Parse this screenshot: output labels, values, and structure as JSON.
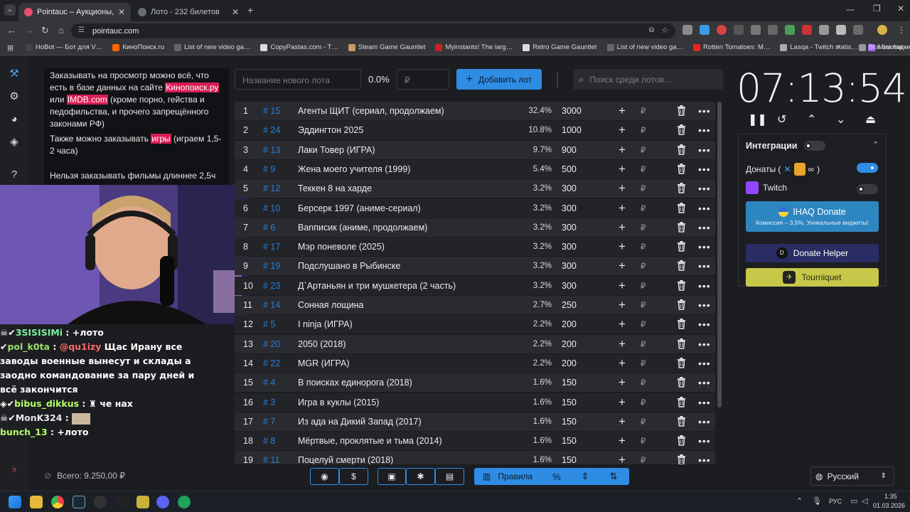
{
  "browser": {
    "tabs": [
      {
        "title": "Pointauc – Аукционы, ястереи…",
        "active": true
      },
      {
        "title": "Лото - 232 билетов",
        "active": false
      }
    ],
    "url": "pointauc.com",
    "bookmarks": [
      "HoBot — Бот для V…",
      "КиноПоиск.ru",
      "List of new video ga…",
      "CopyPastas.com - T…",
      "Steam Game Gauntlet",
      "Myinstants! The larg…",
      "Retro Game Gauntlet",
      "List of new video ga…",
      "Rotten Tomatoes: M…",
      "Lasqa - Twitch statis…",
      "Minichat – The Fast…"
    ],
    "all_bookmarks": "Все закладки"
  },
  "rules_panel": {
    "p1_a": "Заказывать на просмотр можно всё, что есть в базе данных на сайте ",
    "p1_link1": "Кинопоиск.ру",
    "p1_b": " или ",
    "p1_link2": "IMDB.com",
    "p1_c": " (кроме порно, гейства и педофильства, и прочего запрещённого законами РФ)",
    "p2_a": "Также можно заказывать ",
    "p2_hl": "игры",
    "p2_b": " (играем 1,5-2 часа)",
    "p3": "Нельзя заказывать фильмы длиннее 2,5ч"
  },
  "chat": [
    {
      "user": "3SISISIMi",
      "sep": " : ",
      "msg": "+лото"
    },
    {
      "user": "pol_k0ta",
      "sep": " : ",
      "mention": "@qu1izy",
      "msg": " Щас Ирану все заводы военные вынесут и склады а заодно командование за пару дней и всё закончится"
    },
    {
      "user": "bibus_dikkus",
      "sep": " : ",
      "msg": "че нах"
    },
    {
      "user": "MonK324",
      "sep": " : ",
      "msg": ""
    },
    {
      "user": "bunch_13",
      "sep": " : ",
      "msg": "+лото"
    }
  ],
  "footer": {
    "total": "Всего: 9.250,00 ₽"
  },
  "controls": {
    "lot_placeholder": "Название нового лота",
    "percent": "0.0%",
    "rub_placeholder": "₽",
    "add_button": "Добавить лот",
    "search_placeholder": "Поиск среди лотов..."
  },
  "lots": [
    {
      "num": "1",
      "id": "# 15",
      "name": "Агенты ЩИТ (сериал, продолжаем)",
      "pct": "32.4%",
      "amount": "3000"
    },
    {
      "num": "2",
      "id": "# 24",
      "name": "Эддингтон 2025",
      "pct": "10.8%",
      "amount": "1000"
    },
    {
      "num": "3",
      "id": "# 13",
      "name": "Лаки Товер (ИГРА)",
      "pct": "9.7%",
      "amount": "900"
    },
    {
      "num": "4",
      "id": "# 9",
      "name": "Жена моего учителя (1999)",
      "pct": "5.4%",
      "amount": "500"
    },
    {
      "num": "5",
      "id": "# 12",
      "name": "Теккен 8 на харде",
      "pct": "3.2%",
      "amount": "300"
    },
    {
      "num": "6",
      "id": "# 10",
      "name": "Берсерк 1997 (аниме-сериал)",
      "pct": "3.2%",
      "amount": "300"
    },
    {
      "num": "7",
      "id": "# 6",
      "name": "Вanписик (аниме, продолжаем)",
      "pct": "3.2%",
      "amount": "300"
    },
    {
      "num": "8",
      "id": "# 17",
      "name": "Мэр поневоле (2025)",
      "pct": "3.2%",
      "amount": "300"
    },
    {
      "num": "9",
      "id": "# 19",
      "name": "Подслушано в Рыбинске",
      "pct": "3.2%",
      "amount": "300"
    },
    {
      "num": "10",
      "id": "# 23",
      "name": "Д`Артаньян и три мушкетера (2 часть)",
      "pct": "3.2%",
      "amount": "300"
    },
    {
      "num": "11",
      "id": "# 14",
      "name": "Сонная лощина",
      "pct": "2.7%",
      "amount": "250"
    },
    {
      "num": "12",
      "id": "# 5",
      "name": "I ninja (ИГРА)",
      "pct": "2.2%",
      "amount": "200"
    },
    {
      "num": "13",
      "id": "# 20",
      "name": "2050 (2018)",
      "pct": "2.2%",
      "amount": "200"
    },
    {
      "num": "14",
      "id": "# 22",
      "name": "MGR (ИГРА)",
      "pct": "2.2%",
      "amount": "200"
    },
    {
      "num": "15",
      "id": "# 4",
      "name": "В поисках единорога (2018)",
      "pct": "1.6%",
      "amount": "150"
    },
    {
      "num": "16",
      "id": "# 3",
      "name": "Игра в куклы (2015)",
      "pct": "1.6%",
      "amount": "150"
    },
    {
      "num": "17",
      "id": "# 7",
      "name": "Из ада на Дикий Запад (2017)",
      "pct": "1.6%",
      "amount": "150"
    },
    {
      "num": "18",
      "id": "# 8",
      "name": "Мёртвые, проклятые и тьма (2014)",
      "pct": "1.6%",
      "amount": "150"
    },
    {
      "num": "19",
      "id": "# 11",
      "name": "Поцелуй смерти (2018)",
      "pct": "1.6%",
      "amount": "150"
    }
  ],
  "currency_symbol": "₽",
  "toolbar": {
    "rules": "Правила"
  },
  "timer": "07:13:54",
  "integrations": {
    "title": "Интеграции",
    "donations": "Донаты (",
    "donations_end": ")",
    "twitch": "Twitch",
    "ihaq_title": "IHAQ Donate",
    "ihaq_sub": "Комиссия – 3,5%. Уникальные виджеты!",
    "donate_helper": "Donate Helper",
    "tourniquet": "Tourniquet"
  },
  "language": "Русский",
  "taskbar": {
    "lang": "РУС",
    "time": "1:35",
    "date": "01.03.2026"
  },
  "colors": {
    "accent": "#2f8ce3",
    "highlight": "#d81d55",
    "tourniquet": "#c7c749",
    "ihaq": "#2e86c1"
  }
}
